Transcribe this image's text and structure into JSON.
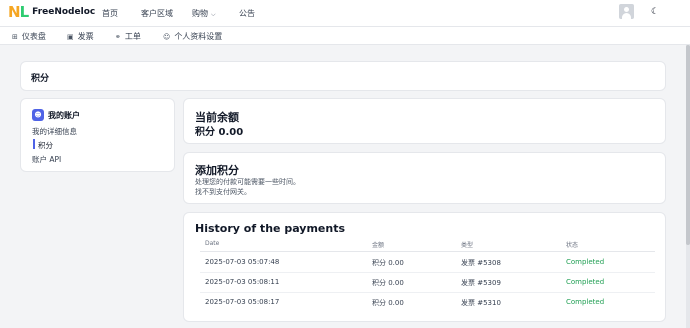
{
  "brand": {
    "logo_n": "N",
    "logo_l": "L",
    "name": "FreeNodeloc"
  },
  "topnav": {
    "home": "首页",
    "client_area": "客户区域",
    "shop": "购物",
    "announcements": "公告"
  },
  "subnav": {
    "dashboard": "仪表盘",
    "invoices": "发票",
    "tickets": "工单",
    "profile_settings": "个人资料设置"
  },
  "page": {
    "title": "积分"
  },
  "account_card": {
    "title": "我的账户",
    "links": [
      "我的详细信息",
      "积分",
      "账户 API"
    ],
    "active_index": 1
  },
  "balance_card": {
    "title": "当前余额",
    "amount": "积分 0.00"
  },
  "add_credit_card": {
    "title": "添加积分",
    "line1": "处理您的付款可能需要一些时间。",
    "line2": "找不到支付网关。"
  },
  "history": {
    "title": "History of the payments",
    "columns": [
      "Date",
      "金额",
      "类型",
      "状态"
    ],
    "rows": [
      {
        "date": "2025-07-03 05:07:48",
        "amount": "积分 0.00",
        "type": "发票 #5308",
        "status": "Completed"
      },
      {
        "date": "2025-07-03 05:08:11",
        "amount": "积分 0.00",
        "type": "发票 #5309",
        "status": "Completed"
      },
      {
        "date": "2025-07-03 05:08:17",
        "amount": "积分 0.00",
        "type": "发票 #5310",
        "status": "Completed"
      }
    ]
  },
  "colors": {
    "accent": "#4f63e6",
    "status_completed": "#22a055",
    "logo_n": "#f5a623",
    "logo_l": "#2ecc71"
  },
  "icons": {
    "dashboard": "grid-icon",
    "invoices": "document-icon",
    "tickets": "headset-icon",
    "profile": "user-icon",
    "theme": "moon-icon",
    "account": "user-circle-icon"
  }
}
